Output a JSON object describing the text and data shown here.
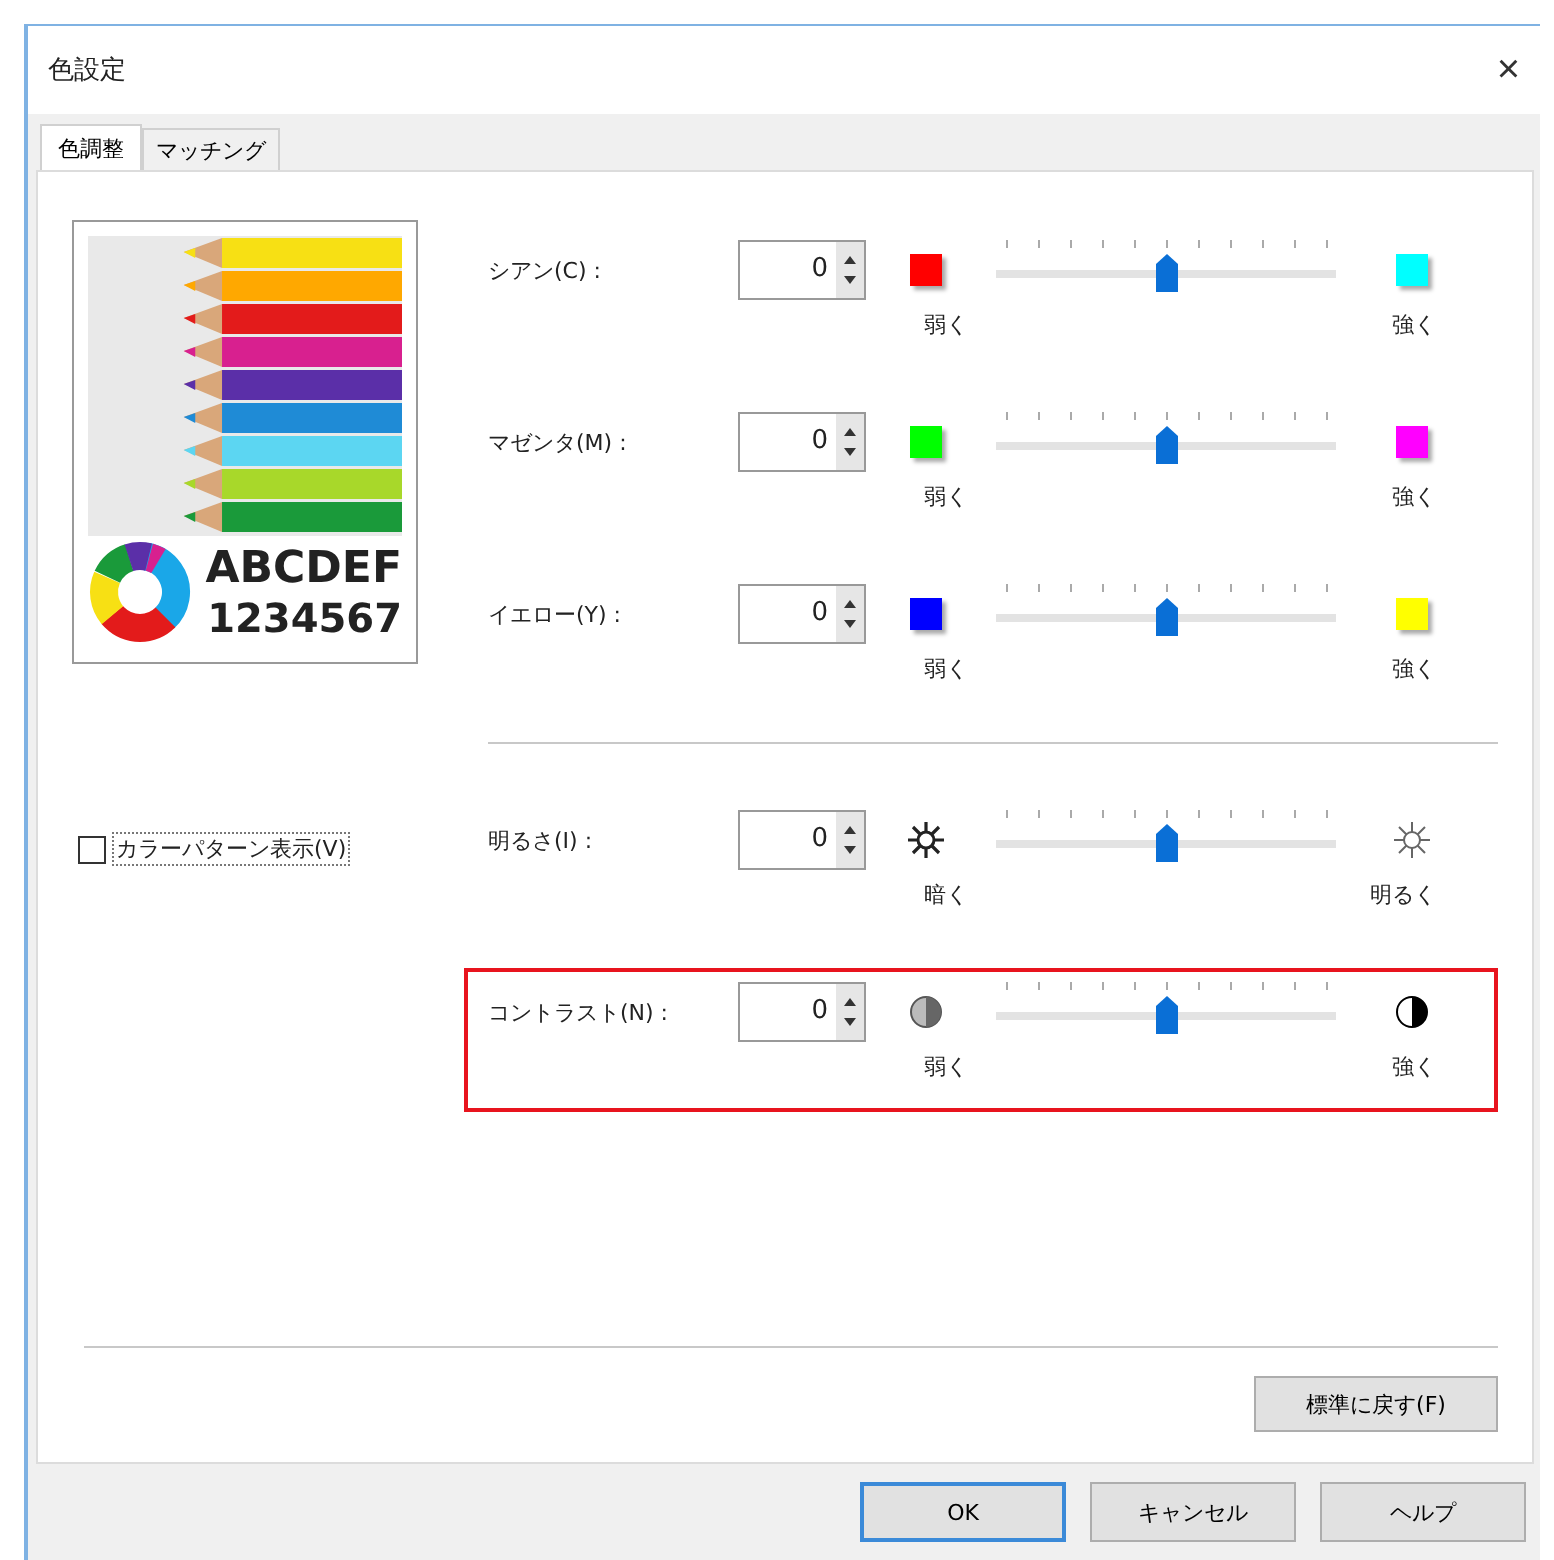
{
  "window": {
    "title": "色設定",
    "close": "×"
  },
  "tabs": [
    {
      "label": "色調整",
      "selected": true
    },
    {
      "label": "マッチング",
      "selected": false
    }
  ],
  "preview": {
    "text_1": "ABCDEF",
    "text_2": "1234567"
  },
  "color_pattern_checkbox": {
    "label": "カラーパターン表示(V)",
    "checked": false
  },
  "adjustments": [
    {
      "label": "シアン(C) :",
      "value": "0",
      "level": 0.5,
      "kind": "swatch",
      "low": {
        "color": "#ff0000"
      },
      "high": {
        "color": "#00ffff"
      },
      "low_label": "弱く",
      "high_label": "強く",
      "highlighted": false
    },
    {
      "label": "マゼンタ(M) :",
      "value": "0",
      "level": 0.5,
      "kind": "swatch",
      "low": {
        "color": "#00ff00"
      },
      "high": {
        "color": "#ff00ff"
      },
      "low_label": "弱く",
      "high_label": "強く",
      "highlighted": false
    },
    {
      "label": "イエロー(Y) :",
      "value": "0",
      "level": 0.5,
      "kind": "swatch",
      "low": {
        "color": "#0000ff"
      },
      "high": {
        "color": "#ffff00"
      },
      "low_label": "弱く",
      "high_label": "強く",
      "highlighted": false
    },
    {
      "label": "明るさ(I) :",
      "value": "0",
      "level": 0.5,
      "kind": "brightness",
      "low_label": "暗く",
      "high_label": "明るく",
      "highlighted": false
    },
    {
      "label": "コントラスト(N) :",
      "value": "0",
      "level": 0.5,
      "kind": "contrast",
      "low_label": "弱く",
      "high_label": "強く",
      "highlighted": true
    }
  ],
  "reset_button": "標準に戻す(F)",
  "buttons": [
    {
      "label": "OK",
      "default": true
    },
    {
      "label": "キャンセル",
      "default": false
    },
    {
      "label": "ヘルプ",
      "default": false
    }
  ]
}
